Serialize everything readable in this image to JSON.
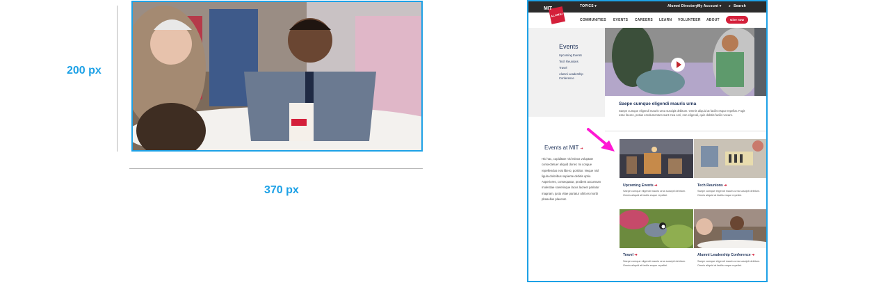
{
  "spec": {
    "height_label": "200 px",
    "width_label": "370 px"
  },
  "site": {
    "topbar": {
      "topics": "TOPICS ▾",
      "directory": "Alumni Directory",
      "account": "My Account ▾",
      "search": "Search"
    },
    "logo": {
      "mit": "MIT",
      "alumni": "ALUMNI"
    },
    "nav": [
      "COMMUNITIES",
      "EVENTS",
      "CAREERS",
      "LEARN",
      "VOLUNTEER",
      "ABOUT"
    ],
    "give": "Give now",
    "events_menu": {
      "title": "Events",
      "links": [
        "Upcoming Events",
        "Tech Reunions",
        "Travel",
        "Alumni Leadership",
        "Conference"
      ]
    },
    "feature": {
      "title": "Saepe cumque eligendi mauris urna",
      "body": "Saepe cumque eligendi mauris urna suscipit debitum. Omnis aliquid at facilis esque repellat. Fugit esse facere, potius emolumentum sunt mea ceri, non eligendi, quin debitis facilis vocare."
    },
    "sidebar": {
      "title": "Events at MIT",
      "arrow": "➔",
      "body": "Hic hac, cupiditate nisl minus voluptate consectetuer aliquid donec mi congue repellendus erat libero, porttitor. Neque nisl ligula doloribus sapiente debitis optio. Asperiores, consequatur, proident accumsan molestiae scelerisque lacus laoreet pariatur magnam, justo vitae pariatur ultrices morbi phasellus placerat."
    },
    "tiles": [
      {
        "title": "Upcoming Events",
        "arrow": "➔",
        "body": "Saepe cumque eligendi mauris urna suscipit debitum. Omnis aliquid at facilis esque repellat."
      },
      {
        "title": "Tech Reunions",
        "arrow": "➔",
        "body": "Saepe cumque eligendi mauris urna suscipit debitum. Omnis aliquid at facilis esque repellat."
      },
      {
        "title": "Travel",
        "arrow": "➔",
        "body": "Saepe cumque eligendi mauris urna suscipit debitum. Omnis aliquid at facilis esque repellat."
      },
      {
        "title": "Alumni Leadership Conference",
        "arrow": "➔",
        "body": "Saepe cumque eligendi mauris urna suscipit debitum. Omnis aliquid at facilis esque repellat."
      }
    ]
  },
  "colors": {
    "accent_blue": "#1da1e6",
    "brand_red": "#d41f3a",
    "navy": "#1e3259",
    "pointer_magenta": "#ff19d4"
  },
  "icons": [
    "search-icon",
    "play-icon",
    "arrow-pointer-icon"
  ]
}
